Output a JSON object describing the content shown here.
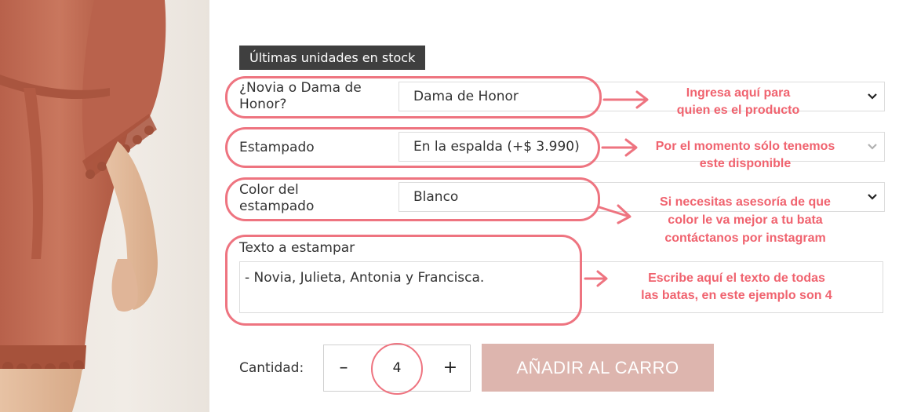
{
  "stock_badge": "Últimas unidades en stock",
  "fields": {
    "role": {
      "label_line1": "¿Novia o Dama de",
      "label_line2": "Honor?",
      "value": "Dama de Honor"
    },
    "print": {
      "label": "Estampado",
      "value": "En la espalda (+$ 3.990)"
    },
    "print_color": {
      "label_line1": "Color del",
      "label_line2": "estampado",
      "value": "Blanco"
    },
    "print_text": {
      "label": "Texto a estampar",
      "value": "- Novia, Julieta, Antonia y Francisca."
    }
  },
  "annotations": {
    "role": {
      "line1": "Ingresa aquí para",
      "line2": "quien es el producto"
    },
    "print": {
      "line1": "Por el momento sólo tenemos",
      "line2": "este disponible"
    },
    "print_color": {
      "line1": "Si necesitas asesoría de que",
      "line2": "color le va mejor a tu bata",
      "line3": "contáctanos por instagram"
    },
    "print_text": {
      "line1": "Escribe aquí el texto de todas",
      "line2": "las batas, en este ejemplo son 4"
    }
  },
  "quantity": {
    "label": "Cantidad:",
    "minus": "–",
    "value": "4",
    "plus": "+"
  },
  "add_to_cart": "AÑADIR AL CARRO",
  "colors": {
    "annotation": "#f0636f",
    "ring": "#ee7480",
    "cart_button": "#ddb5ae",
    "badge": "#3f3f3f",
    "robe": "#c0705a"
  },
  "icons": {
    "select_caret": "chevron-down-icon",
    "arrow": "arrow-right-icon"
  }
}
